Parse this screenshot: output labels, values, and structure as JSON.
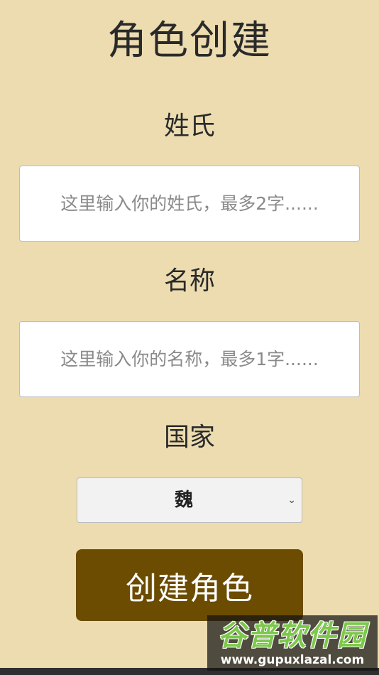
{
  "page": {
    "title": "角色创建"
  },
  "form": {
    "surname": {
      "label": "姓氏",
      "placeholder": "这里输入你的姓氏，最多2字......",
      "value": ""
    },
    "name": {
      "label": "名称",
      "placeholder": "这里输入你的名称，最多1字......",
      "value": ""
    },
    "country": {
      "label": "国家",
      "selected": "魏"
    },
    "submit_label": "创建角色"
  },
  "watermark": {
    "logo": "谷普软件园",
    "url": "www.gupuxlazal.com"
  },
  "colors": {
    "background": "#ecdcb0",
    "button": "#6b4c00",
    "button_text": "#ffffff"
  }
}
